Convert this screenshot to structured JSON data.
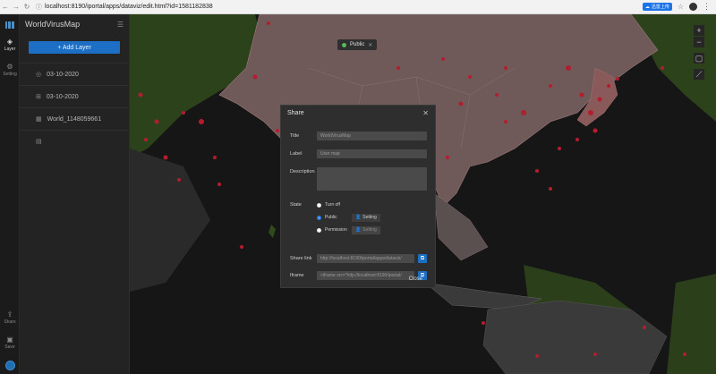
{
  "browser": {
    "url": "localhost:8190/iportal/apps/dataviz/edit.html?id=1581182838",
    "ext_label": "迅雷上传"
  },
  "rail": {
    "items": [
      {
        "label": "Layer",
        "icon": "layers-icon"
      },
      {
        "label": "Setting",
        "icon": "gear-icon"
      }
    ],
    "bottom": [
      {
        "label": "Share",
        "icon": "share-icon"
      },
      {
        "label": "Save",
        "icon": "save-icon"
      }
    ]
  },
  "panel": {
    "title": "WorldVirusMap",
    "add_layer": "+ Add Layer",
    "layers": [
      {
        "name": "03-10-2020",
        "icon": "heat-layer-icon"
      },
      {
        "name": "03-10-2020",
        "icon": "point-layer-icon"
      },
      {
        "name": "World_1148059661",
        "icon": "region-layer-icon"
      },
      {
        "name": "",
        "icon": "base-layer-icon"
      }
    ]
  },
  "map": {
    "badge_label": "Public",
    "zoom_in": "+",
    "zoom_out": "−",
    "colors": {
      "land": "#3a3a3a",
      "highlight": "#6f5959",
      "outline": "#9c7a7a",
      "green": "#2f4a1c",
      "points": "#b31e2e"
    }
  },
  "share": {
    "title": "Share",
    "fields": {
      "title_label": "Title",
      "title_value": "WorldVirusMap",
      "label_label": "Label",
      "label_value": "User map",
      "desc_label": "Description",
      "state_label": "State",
      "share_label": "Share link",
      "share_value": "http://localhost:8190/iportal/apps/dataviz/",
      "iframe_label": "Iframe",
      "iframe_value": "<iframe src=\"http://localhost:8190/iportal/"
    },
    "states": [
      {
        "label": "Turn off",
        "selected": false
      },
      {
        "label": "Public",
        "selected": true,
        "setting": "Setting"
      },
      {
        "label": "Permission",
        "selected": false,
        "setting": "Setting"
      }
    ],
    "close_label": "Close"
  }
}
